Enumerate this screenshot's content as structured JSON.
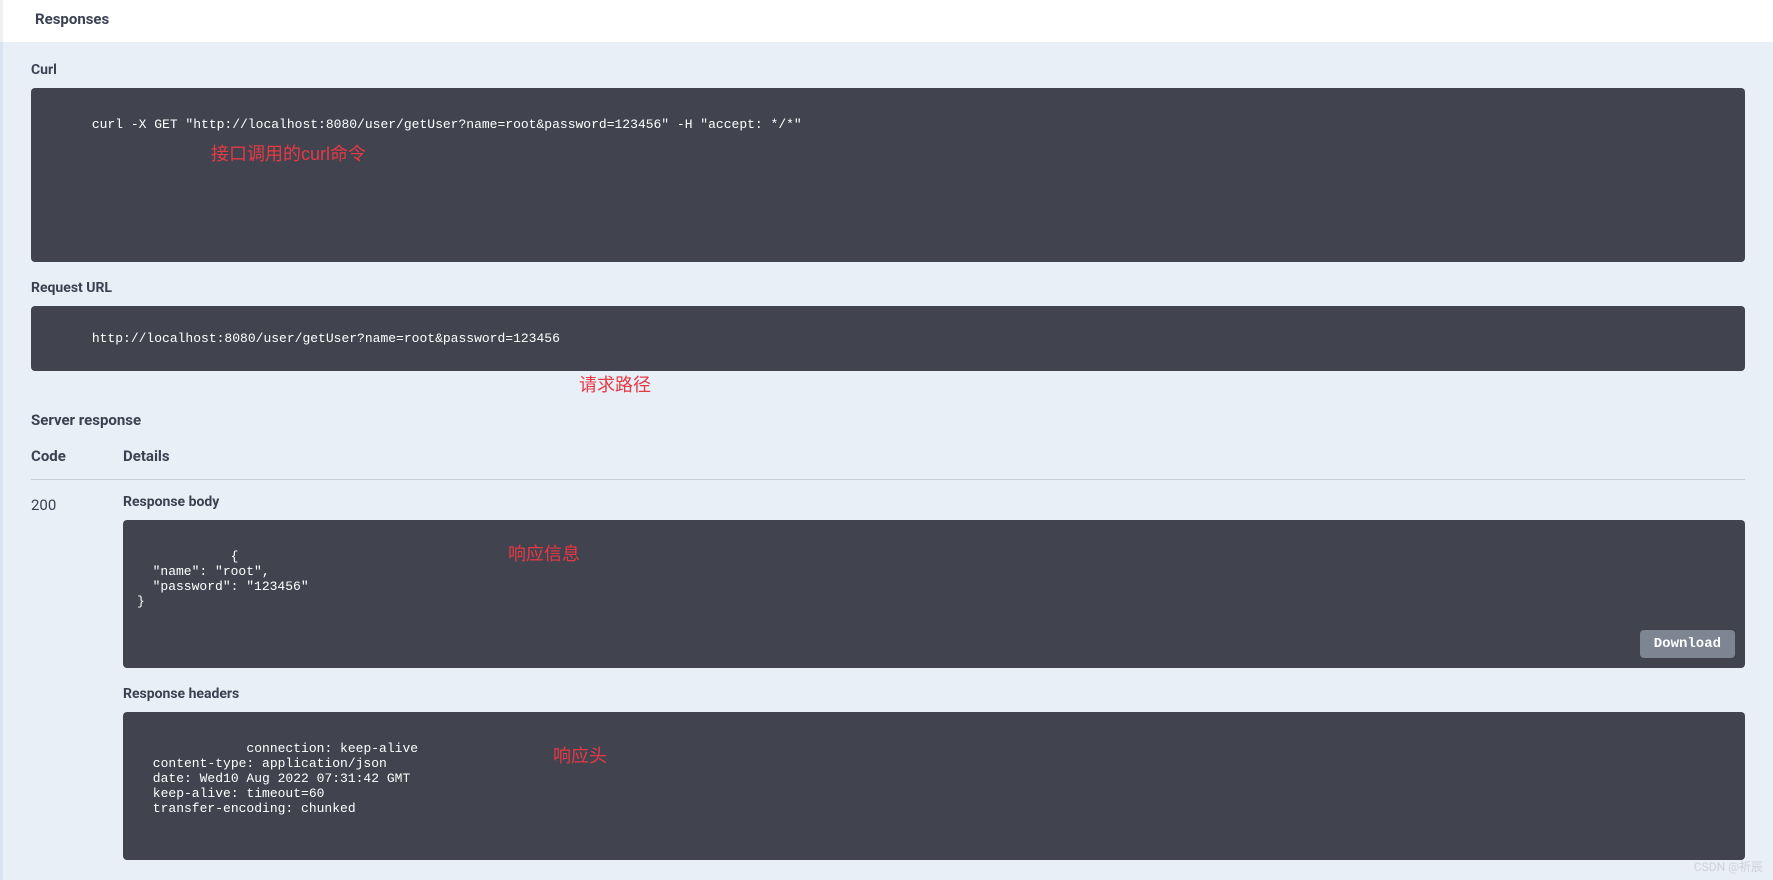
{
  "header": {
    "title": "Responses"
  },
  "curl": {
    "label": "Curl",
    "command": "curl -X GET \"http://localhost:8080/user/getUser?name=root&password=123456\" -H \"accept: */*\"",
    "annotation": "接口调用的curl命令"
  },
  "requestUrl": {
    "label": "Request URL",
    "url": "http://localhost:8080/user/getUser?name=root&password=123456",
    "annotation": "请求路径"
  },
  "serverResponse": {
    "label": "Server response",
    "columns": {
      "code": "Code",
      "details": "Details"
    },
    "statusCode": "200",
    "responseBody": {
      "label": "Response body",
      "content": "{\n  \"name\": \"root\",\n  \"password\": \"123456\"\n}",
      "annotation": "响应信息",
      "downloadLabel": "Download"
    },
    "responseHeaders": {
      "label": "Response headers",
      "content": " connection: keep-alive \n content-type: application/json \n date: Wed10 Aug 2022 07:31:42 GMT \n keep-alive: timeout=60 \n transfer-encoding: chunked ",
      "annotation": "响应头"
    }
  },
  "watermark": "CSDN @祈辰"
}
